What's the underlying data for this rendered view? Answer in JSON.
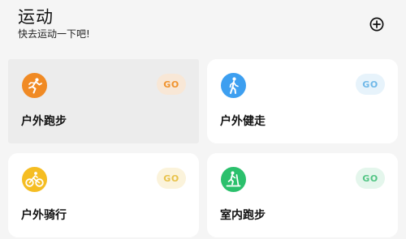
{
  "header": {
    "title": "运动",
    "subtitle": "快去运动一下吧!",
    "add_icon": "plus-circle-icon"
  },
  "cards": [
    {
      "label": "户外跑步",
      "go_label": "GO",
      "icon": "running-icon",
      "icon_color": "#f08a24",
      "go_bg": "#f8e7d6",
      "go_color": "#f0932e",
      "selected": true
    },
    {
      "label": "户外健走",
      "go_label": "GO",
      "icon": "walking-icon",
      "icon_color": "#3d9ff0",
      "go_bg": "#e7f3fb",
      "go_color": "#6fb8e8",
      "selected": false
    },
    {
      "label": "户外骑行",
      "go_label": "GO",
      "icon": "bicycle-icon",
      "icon_color": "#f5bd22",
      "go_bg": "#fbf3db",
      "go_color": "#e8c24a",
      "selected": false
    },
    {
      "label": "室内跑步",
      "go_label": "GO",
      "icon": "treadmill-icon",
      "icon_color": "#2bc06c",
      "go_bg": "#e4f6ec",
      "go_color": "#52c584",
      "selected": false
    }
  ]
}
